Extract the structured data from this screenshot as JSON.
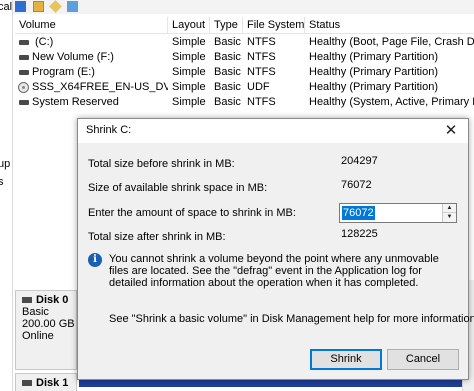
{
  "background": {
    "left_fragments": [
      "cal",
      "up",
      "s"
    ],
    "volume_list": {
      "columns": [
        "Volume",
        "Layout",
        "Type",
        "File System",
        "Status"
      ],
      "rows": [
        {
          "icon": "drive-icon",
          "volume": "(C:)",
          "layout": "Simple",
          "type": "Basic",
          "fs": "NTFS",
          "status": "Healthy (Boot, Page File, Crash Dum"
        },
        {
          "icon": "drive-icon",
          "volume": "New Volume (F:)",
          "layout": "Simple",
          "type": "Basic",
          "fs": "NTFS",
          "status": "Healthy (Primary Partition)"
        },
        {
          "icon": "drive-icon",
          "volume": "Program (E:)",
          "layout": "Simple",
          "type": "Basic",
          "fs": "NTFS",
          "status": "Healthy (Primary Partition)"
        },
        {
          "icon": "cd-icon",
          "volume": "SSS_X64FREE_EN-US_DV9 (D:)",
          "layout": "Simple",
          "type": "Basic",
          "fs": "UDF",
          "status": "Healthy (Primary Partition)"
        },
        {
          "icon": "drive-icon",
          "volume": "System Reserved",
          "layout": "Simple",
          "type": "Basic",
          "fs": "NTFS",
          "status": "Healthy (System, Active, Primary Par"
        }
      ]
    },
    "disks": [
      {
        "name": "Disk 0",
        "kind": "Basic",
        "size": "200.00 GB",
        "state": "Online"
      },
      {
        "name": "Disk 1"
      }
    ]
  },
  "dialog": {
    "title": "Shrink C:",
    "close_glyph": "✕",
    "fields": {
      "total_before_label": "Total size before shrink in MB:",
      "total_before_value": "204297",
      "available_label": "Size of available shrink space in MB:",
      "available_value": "76072",
      "amount_label": "Enter the amount of space to shrink in MB:",
      "amount_value": "76072",
      "total_after_label": "Total size after shrink in MB:",
      "total_after_value": "128225"
    },
    "info_text": "You cannot shrink a volume beyond the point where any unmovable files are located. See the \"defrag\" event in the Application log for detailed information about the operation when it has completed.",
    "help_text": "See \"Shrink a basic volume\" in Disk Management help for more information",
    "buttons": {
      "shrink": "Shrink",
      "cancel": "Cancel"
    }
  },
  "colors": {
    "selection": "#0078d7",
    "partition_header": "#1f3d99",
    "info_icon": "#1a5fb4"
  }
}
